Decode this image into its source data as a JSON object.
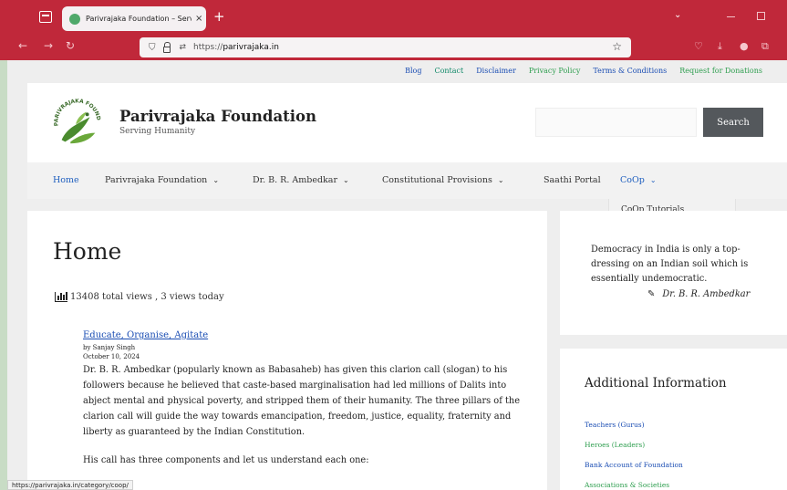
{
  "browser": {
    "tab_title": "Parivrajaka Foundation – Serving Humanity",
    "tab_close": "×",
    "new_tab": "+",
    "tabs_menu": "⌄",
    "url_prefix": "https://",
    "url_host": "parivrajaka.in",
    "back": "←",
    "forward": "→",
    "reload": "↻",
    "star": "☆",
    "status_url": "https://parivrajaka.in/category/coop/"
  },
  "top_links": [
    "Blog",
    "Contact",
    "Disclaimer",
    "Privacy Policy",
    "Terms & Conditions",
    "Request for Donations"
  ],
  "header": {
    "logo_text": "PARIVRAJAKA FOUNDATION",
    "site_title": "Parivrajaka Foundation",
    "tagline": "Serving Humanity",
    "search_placeholder": "",
    "search_button": "Search"
  },
  "nav": {
    "home": "Home",
    "foundation": "Parivrajaka Foundation",
    "ambedkar": "Dr. B. R. Ambedkar",
    "constitutional": "Constitutional Provisions",
    "saathi": "Saathi Portal",
    "coop": "CoOp",
    "coop_submenu": "CoOp Tutorials"
  },
  "content": {
    "page_title": "Home",
    "views_text": "13408 total views , 3 views today",
    "post": {
      "title": "Educate, Organise, Agitate",
      "author": "by Sanjay Singh",
      "date": "October 10, 2024",
      "body": "Dr. B. R. Ambedkar (popularly known as Babasaheb) has given this clarion call (slogan) to his followers because he believed that caste-based marginalisation had led millions of Dalits into abject mental and physical poverty, and stripped them of their humanity. The three pillars of the clarion call will guide the way towards emancipation, freedom, justice, equality, fraternity and liberty as guaranteed by the Indian Constitution.",
      "body2": "His call has three components and let us understand each one:"
    }
  },
  "sidebar": {
    "quote": "Democracy in India is only a top-dressing on an Indian soil which is essentially undemocratic.",
    "quote_author": "Dr. B. R. Ambedkar",
    "info_title": "Additional Information",
    "info_links": [
      "Teachers (Gurus)",
      "Heroes (Leaders)",
      "Bank Account of Foundation",
      "Associations & Societies"
    ]
  },
  "colors": {
    "browser_chrome": "#c0283a",
    "link_blue": "#1a4db3",
    "link_green": "#2e9e4f",
    "search_button": "#54585c"
  }
}
